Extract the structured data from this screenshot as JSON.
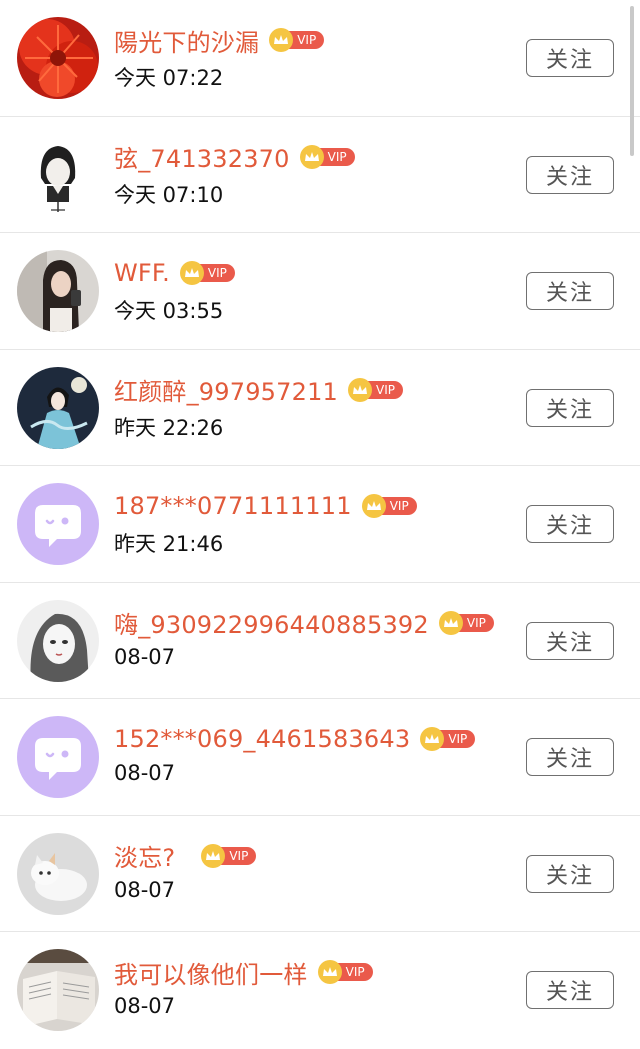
{
  "follow_label": "关注",
  "vip_label": "VIP",
  "users": [
    {
      "name": "陽光下的沙漏",
      "time": "今天 07:22",
      "avatar": "red-flower-photo"
    },
    {
      "name": "弦_741332370",
      "time": "今天 07:10",
      "avatar": "cartoon-girl-sketch"
    },
    {
      "name": "WFF.",
      "time": "今天 03:55",
      "avatar": "girl-mirror-selfie"
    },
    {
      "name": "红颜醉_997957211",
      "time": "昨天 22:26",
      "avatar": "ancient-costume-girl"
    },
    {
      "name": "187***0771111111",
      "time": "昨天 21:46",
      "avatar": "default-chat-face"
    },
    {
      "name": "嗨_930922996440885392",
      "time": "08-07",
      "avatar": "grayscale-girl-drawing"
    },
    {
      "name": "152***069_4461583643",
      "time": "08-07",
      "avatar": "default-chat-face"
    },
    {
      "name": "淡忘?",
      "time": "08-07",
      "avatar": "white-kitten-photo"
    },
    {
      "name": "我可以像他们一样",
      "time": "08-07",
      "avatar": "open-book-photo"
    }
  ],
  "colors": {
    "name": "#e15a3a",
    "vip_tag": "#ea5a4b",
    "crown": "#f5c542",
    "default_avatar": "#cdb7f7"
  }
}
